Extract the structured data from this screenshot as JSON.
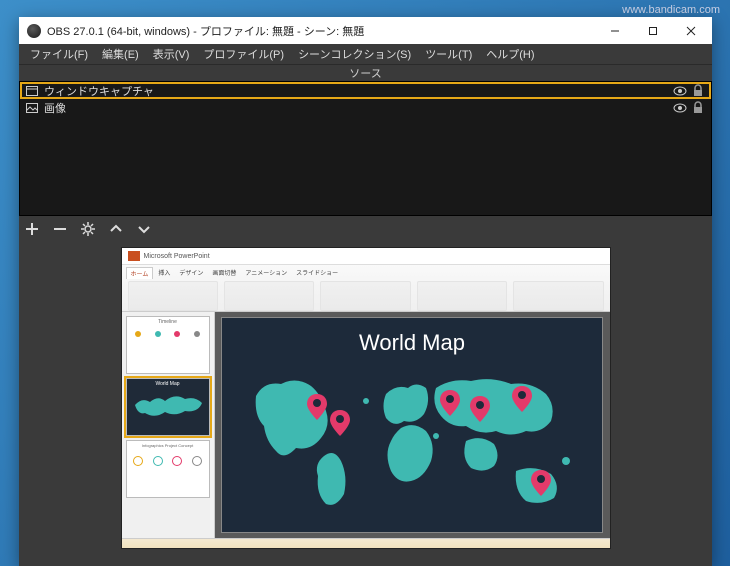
{
  "watermark": "www.bandicam.com",
  "window": {
    "title": "OBS 27.0.1 (64-bit, windows) - プロファイル: 無題 - シーン: 無題"
  },
  "menu": {
    "file": "ファイル(F)",
    "edit": "編集(E)",
    "view": "表示(V)",
    "profile": "プロファイル(P)",
    "scenecol": "シーンコレクション(S)",
    "tools": "ツール(T)",
    "help": "ヘルプ(H)"
  },
  "sources": {
    "header": "ソース",
    "items": [
      {
        "label": "ウィンドウキャプチャ",
        "icon": "window"
      },
      {
        "label": "画像",
        "icon": "image"
      }
    ]
  },
  "preview": {
    "app": "Microsoft PowerPoint",
    "slide_title": "World Map",
    "thumbs": [
      {
        "label": "Timeline"
      },
      {
        "label": "World Map"
      },
      {
        "label": "Infographics  Project Concept"
      }
    ]
  },
  "colors": {
    "highlight": "#e6a817",
    "land": "#3fb9b1",
    "pin": "#e33a6a",
    "slide_bg": "#1d2a3a"
  }
}
